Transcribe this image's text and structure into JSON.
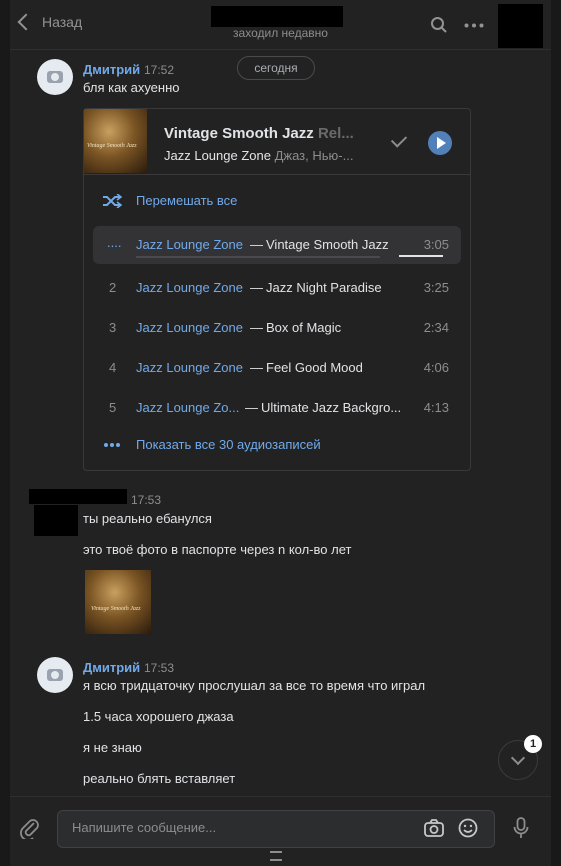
{
  "header": {
    "back_label": "Назад",
    "status": "заходил недавно"
  },
  "date_separator": "сегодня",
  "messages": {
    "m1": {
      "author": "Дмитрий",
      "time": "17:52",
      "text": "бля как ахуенно"
    },
    "m2": {
      "time": "17:53",
      "lines": [
        "ты реально ебанулся",
        "это твоё фото в паспорте через n кол-во лет"
      ]
    },
    "m3": {
      "author": "Дмитрий",
      "time": "17:53",
      "lines": [
        "я всю тридцаточку прослушал за все то время что играл",
        "1.5 часа хорошего джаза",
        "я не знаю",
        "реально блять вставляет"
      ]
    }
  },
  "playlist": {
    "title": "Vintage Smooth Jazz",
    "title_faded": "Rel...",
    "artist": "Jazz Lounge Zone",
    "genre": "Джаз, Нью-...",
    "cover_text": "Vintage Smooth Jazz",
    "shuffle_label": "Перемешать все",
    "dash": "—",
    "tracks": [
      {
        "num": "....",
        "artist": "Jazz Lounge Zone",
        "title": "Vintage Smooth Jazz",
        "duration": "3:05",
        "active": true
      },
      {
        "num": "2",
        "artist": "Jazz Lounge Zone",
        "title": "Jazz Night Paradise",
        "duration": "3:25"
      },
      {
        "num": "3",
        "artist": "Jazz Lounge Zone",
        "title": "Box of Magic",
        "duration": "2:34"
      },
      {
        "num": "4",
        "artist": "Jazz Lounge Zone",
        "title": "Feel Good Mood",
        "duration": "4:06"
      },
      {
        "num": "5",
        "artist": "Jazz Lounge Zo...",
        "title": "Ultimate Jazz Backgro...",
        "duration": "4:13"
      }
    ],
    "show_all": "Показать все 30 аудиозаписей"
  },
  "photo_caption": "Vintage Smooth Jazz",
  "unread_badge": "1",
  "composer": {
    "placeholder": "Напишите сообщение..."
  },
  "icons": {
    "back": "chevron-left-icon",
    "search": "search-icon",
    "more": "more-horizontal-icon",
    "attach": "paperclip-icon",
    "camera": "camera-icon",
    "emoji": "smile-icon",
    "mic": "microphone-icon"
  },
  "colors": {
    "accent": "#71aaeb",
    "play": "#5181b8",
    "background": "#222222"
  }
}
